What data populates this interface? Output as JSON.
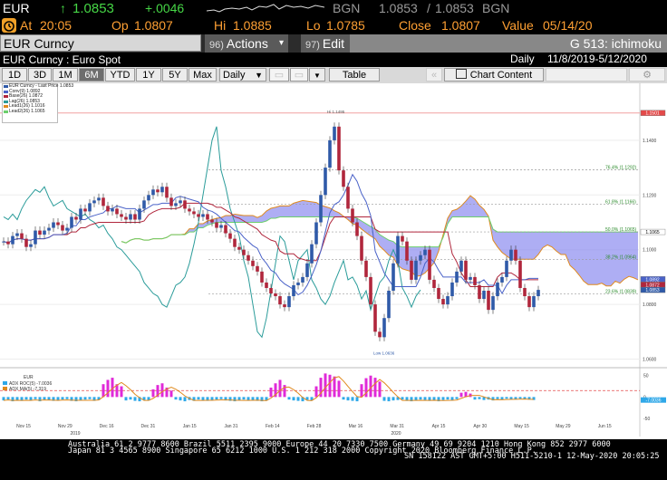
{
  "quote": {
    "ticker": "EUR",
    "arrow": "↑",
    "last": "1.0853",
    "change": "+.0046",
    "bid_source": "BGN",
    "bid": "1.0853",
    "sep": "/",
    "ask": "1.0853",
    "ask_source": "BGN",
    "at_label": "At",
    "time": "20:05",
    "open_label": "Op",
    "open": "1.0807",
    "high_label": "Hi",
    "high": "1.0885",
    "low_label": "Lo",
    "low": "1.0785",
    "close_label": "Close",
    "close": "1.0807",
    "value_label": "Value",
    "value_date": "05/14/20"
  },
  "titlebar": {
    "security": "EUR Curncy",
    "actions_num": "96)",
    "actions_label": "Actions",
    "edit_num": "97)",
    "edit_label": "Edit",
    "function_label": "G 513: ichimoku",
    "dropdown_glyph": "▾"
  },
  "subbar": {
    "description": "EUR Curncy : Euro Spot",
    "frequency": "Daily",
    "date_range": "11/8/2019-5/12/2020"
  },
  "toolbar": {
    "periods": [
      "1D",
      "3D",
      "1M",
      "6M",
      "YTD",
      "1Y",
      "5Y",
      "Max"
    ],
    "selected_period": "6M",
    "frequency": "Daily",
    "table_label": "Table",
    "chart_content_label": "Chart Content",
    "back_arrows": "«",
    "gear_glyph": "⚙"
  },
  "legend": {
    "items": [
      {
        "label": "EUR Curncy - Last Price 1.0853",
        "color": "#2f5aa8"
      },
      {
        "label": "Conv(9)   1.0892",
        "color": "#4a62c8"
      },
      {
        "label": "Base(26)  1.0872",
        "color": "#b0263c"
      },
      {
        "label": "Lag(26)   1.0853",
        "color": "#2b9c9a"
      },
      {
        "label": "Lead1(26) 1.1016",
        "color": "#e08a1e"
      },
      {
        "label": "Lead2(26) 1.1065",
        "color": "#6ccf6c"
      }
    ]
  },
  "chart_data": [
    {
      "type": "candlestick",
      "title": "",
      "ylim": [
        1.0595,
        1.1562
      ],
      "right_axis_ticks": [
        "1.1400",
        "1.1200",
        "1.1000",
        "1.0800",
        "1.0600"
      ],
      "right_axis_tags": [
        {
          "value": 1.15,
          "label": "1.1501",
          "color": "#e34a4a"
        },
        {
          "value": 1.1065,
          "label": "1.1065",
          "color": "#ffffff"
        },
        {
          "value": 1.0892,
          "label": "1.0892",
          "color": "#4a62c8"
        },
        {
          "value": 1.0872,
          "label": "1.0872",
          "color": "#b0263c"
        },
        {
          "value": 1.0853,
          "label": "1.0853",
          "color": "#2f5aa8"
        }
      ],
      "x_tick_labels": [
        "Nov 15",
        "Nov 29",
        "Dec 16",
        "Dec 31",
        "Jan 15",
        "Jan 31",
        "Feb 14",
        "Feb 28",
        "Mar 16",
        "Mar 31",
        "Apr 15",
        "Apr 30",
        "May 15",
        "May 29",
        "Jun 15"
      ],
      "year_labels": [
        "2019",
        "2020"
      ],
      "annotations": [
        {
          "text": "Hi 1.1495",
          "value": 1.1495
        },
        {
          "text": "Low 1.0636",
          "value": 1.0636
        }
      ],
      "fib_levels": [
        {
          "text": "76.4% (1.1292)",
          "value": 1.1292
        },
        {
          "text": "61.8% (1.1166)",
          "value": 1.1166
        },
        {
          "text": "50.0% (1.1065)",
          "value": 1.1065
        },
        {
          "text": "38.2% (1.0964)",
          "value": 1.0964
        },
        {
          "text": "23.6% (1.0839)",
          "value": 1.0839
        }
      ],
      "closes": [
        1.103,
        1.102,
        1.105,
        1.106,
        1.104,
        1.101,
        1.102,
        1.107,
        1.1055,
        1.107,
        1.108,
        1.11,
        1.109,
        1.107,
        1.108,
        1.112,
        1.111,
        1.115,
        1.114,
        1.117,
        1.118,
        1.119,
        1.116,
        1.114,
        1.115,
        1.113,
        1.112,
        1.111,
        1.113,
        1.111,
        1.115,
        1.118,
        1.12,
        1.122,
        1.121,
        1.123,
        1.119,
        1.116,
        1.117,
        1.118,
        1.115,
        1.114,
        1.113,
        1.112,
        1.113,
        1.111,
        1.11,
        1.108,
        1.109,
        1.106,
        1.104,
        1.101,
        1.1,
        1.098,
        1.096,
        1.094,
        1.092,
        1.088,
        1.086,
        1.084,
        1.083,
        1.08,
        1.079,
        1.083,
        1.087,
        1.088,
        1.09,
        1.095,
        1.102,
        1.11,
        1.12,
        1.13,
        1.14,
        1.145,
        1.129,
        1.123,
        1.115,
        1.11,
        1.105,
        1.096,
        1.09,
        1.08,
        1.07,
        1.068,
        1.075,
        1.085,
        1.095,
        1.105,
        1.103,
        1.096,
        1.089,
        1.096,
        1.098,
        1.1,
        1.089,
        1.086,
        1.082,
        1.08,
        1.083,
        1.088,
        1.092,
        1.096,
        1.089,
        1.09,
        1.087,
        1.082,
        1.085,
        1.078,
        1.083,
        1.088,
        1.09,
        1.096,
        1.1,
        1.096,
        1.086,
        1.083,
        1.079,
        1.083,
        1.0853
      ]
    },
    {
      "type": "bar",
      "title": "EUR",
      "legend": [
        {
          "label": "ADX ROC(5)  -7.0036",
          "color": "#2fa8e8"
        },
        {
          "label": "ADX MA(5)  -7.319",
          "color": "#e08a1e"
        }
      ],
      "right_axis_ticks": [
        "50",
        "0",
        "-50"
      ],
      "right_axis_tag": "-7.0036",
      "ylim": [
        -50,
        60
      ],
      "values": [
        -8,
        -6,
        -10,
        -7,
        -9,
        -6,
        -8,
        -5,
        -10,
        -6,
        -7,
        -9,
        -8,
        -6,
        -5,
        -9,
        -10,
        -8,
        -6,
        -5,
        -9,
        -7,
        30,
        40,
        45,
        30,
        25,
        -8,
        -6,
        -9,
        -10,
        -7,
        -8,
        18,
        28,
        32,
        22,
        15,
        -6,
        -8,
        -10,
        -7,
        -9,
        -6,
        -8,
        -9,
        -7,
        -6,
        -5,
        -8,
        -9,
        -10,
        -7,
        -6,
        -8,
        -7,
        -9,
        -10,
        -8,
        22,
        32,
        40,
        28,
        -6,
        -8,
        -9,
        -10,
        -7,
        -8,
        25,
        45,
        55,
        52,
        48,
        38,
        -6,
        -8,
        -9,
        -10,
        30,
        44,
        50,
        45,
        36,
        -9,
        -10,
        -8,
        -7,
        -6,
        -9,
        -10,
        -8,
        -6,
        -7,
        -9,
        -8,
        -10,
        -7,
        -6,
        -8,
        -5,
        10,
        12,
        8,
        -6,
        -5,
        -7,
        -6,
        -8,
        -5,
        -6,
        -4,
        -5,
        -6,
        -4,
        -5,
        -6,
        -7
      ]
    }
  ],
  "footer": {
    "line1": "Australia 61 2 9777 8600  Brazil 5511 2395 9000  Europe 44 20 7330 7500  Germany 49 69 9204 1210  Hong Kong 852 2977 6000",
    "line2": "Japan 81 3 4565 8900        Singapore 65 6212 1000        U.S. 1 212 318 2000                Copyright 2020 Bloomberg Finance L.P.",
    "line3": "SN 158122 AST  GMT+5:00 H511-5210-1 12-May-2020 20:05:25"
  }
}
